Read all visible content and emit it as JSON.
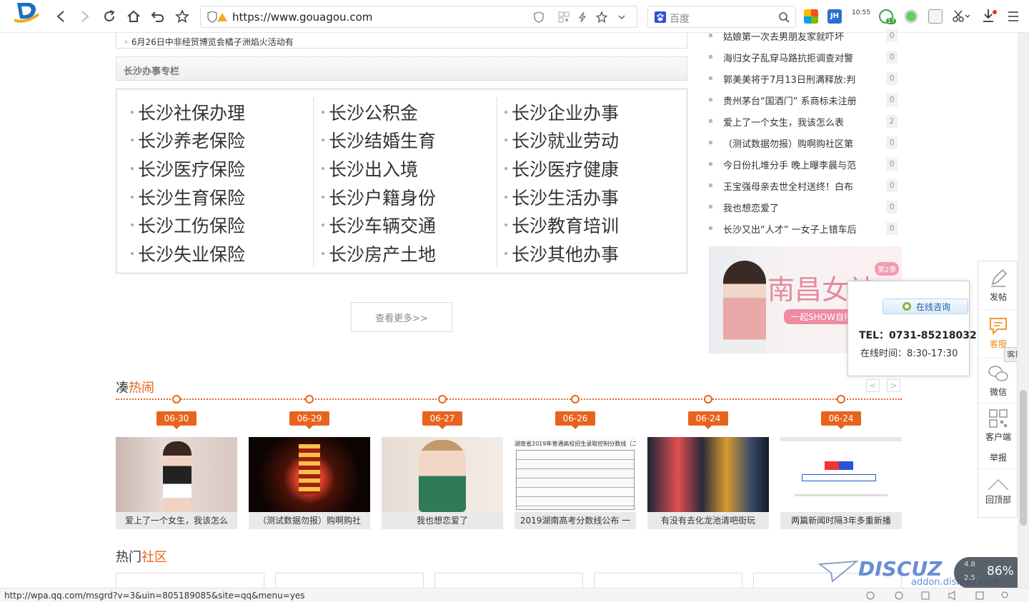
{
  "browser": {
    "url": "https://www.gouagou.com",
    "search_placeholder": "百度",
    "ext_jh": "JH",
    "ext_clock": "10:55",
    "ext_badge": "17"
  },
  "notice": "6月26日中非经贸博览会橘子洲焰火活动有",
  "section_title": "长沙办事专栏",
  "services": {
    "col1": [
      "长沙社保办理",
      "长沙养老保险",
      "长沙医疗保险",
      "长沙生育保险",
      "长沙工伤保险",
      "长沙失业保险"
    ],
    "col2": [
      "长沙公积金",
      "长沙结婚生育",
      "长沙出入境",
      "长沙户籍身份",
      "长沙车辆交通",
      "长沙房产土地"
    ],
    "col3": [
      "长沙企业办事",
      "长沙就业劳动",
      "长沙医疗健康",
      "长沙生活办事",
      "长沙教育培训",
      "长沙其他办事"
    ]
  },
  "more_label": "查看更多>>",
  "hot_list": [
    {
      "title": "姑娘第一次去男朋友家就吓坏",
      "count": "0"
    },
    {
      "title": "海归女子乱穿马路抗拒调查对警",
      "count": "0"
    },
    {
      "title": "郭美美将于7月13日刑满释放:判",
      "count": "0"
    },
    {
      "title": "贵州茅台“国酒门” 系商标未注册",
      "count": "0"
    },
    {
      "title": "爱上了一个女生，我该怎么表",
      "count": "2"
    },
    {
      "title": "（测试数据勿报）购啊购社区第",
      "count": "0"
    },
    {
      "title": "今日份扎堆分手 晚上曝李晨与范",
      "count": "0"
    },
    {
      "title": "王宝强母亲去世全村送终！白布",
      "count": "0"
    },
    {
      "title": "我也想恋爱了",
      "count": "0"
    },
    {
      "title": "长沙又出“人才” 一女子上错车后",
      "count": "0"
    }
  ],
  "banner": {
    "title": "南昌女神",
    "badge": "第2季",
    "tagline": "一起SHOW自拍"
  },
  "popup": {
    "consult": "在线咨询",
    "tel": "TEL：0731-85218032",
    "hours": "在线时间：8:30-17:30"
  },
  "tools": {
    "post": "发帖",
    "service": "客服",
    "service_tip": "客服",
    "wechat": "微信",
    "client": "客户端",
    "report": "举报",
    "top": "回顶部"
  },
  "events_title": {
    "a": "凑",
    "b": "热闹"
  },
  "events": [
    {
      "date": "06-30",
      "caption": "爱上了一个女生，我该怎么"
    },
    {
      "date": "06-29",
      "caption": "（测试数据勿报）购啊购社"
    },
    {
      "date": "06-27",
      "caption": "我也想恋爱了"
    },
    {
      "date": "06-26",
      "caption": "2019湖南高考分数线公布 一"
    },
    {
      "date": "06-24",
      "caption": "有没有去化龙池清吧街玩"
    },
    {
      "date": "06-24",
      "caption": "两篇新闻时隔3年多重新播"
    }
  ],
  "doc_title": "湖南省2019年普通高校招生录取控制分数线（二）",
  "community_title": {
    "a": "热门",
    "b": "社区"
  },
  "status_url": "http://wpa.qq.com/msgrd?v=3&uin=805189085&site=qq&menu=yes",
  "watermark": {
    "logo": "DISCUZ",
    "site": "addon.dismall.com",
    "pct": "86%",
    "up": "4.8",
    "down": "2.5"
  },
  "colors": {
    "accent": "#e8641e",
    "link": "#1e5fa6"
  }
}
